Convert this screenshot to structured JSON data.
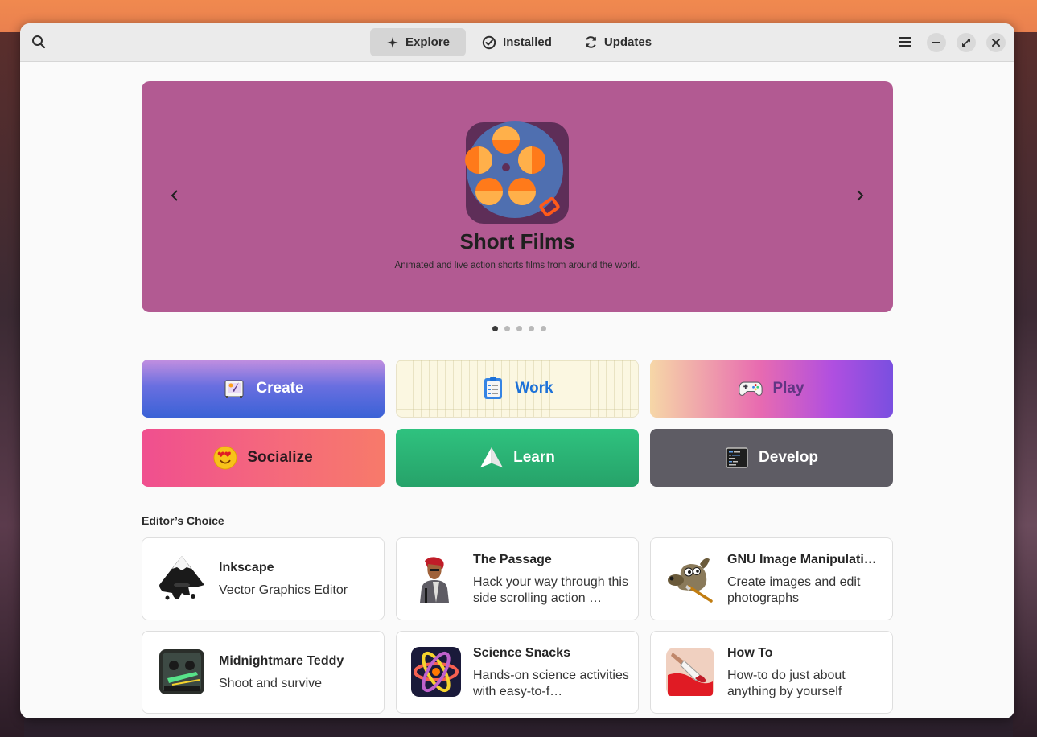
{
  "header": {
    "tabs": [
      {
        "label": "Explore",
        "icon": "explore-icon",
        "active": true
      },
      {
        "label": "Installed",
        "icon": "check-icon",
        "active": false
      },
      {
        "label": "Updates",
        "icon": "refresh-icon",
        "active": false
      }
    ]
  },
  "banner": {
    "title": "Short Films",
    "description": "Animated and live action shorts films from around the world.",
    "color": "#b25a92",
    "page_count": 5,
    "active_page": 1
  },
  "categories": [
    {
      "label": "Create",
      "icon": "create-icon",
      "text_color": "#ffffff"
    },
    {
      "label": "Work",
      "icon": "work-icon",
      "text_color": "#1c71d8"
    },
    {
      "label": "Play",
      "icon": "gamepad-icon",
      "text_color": "#613583"
    },
    {
      "label": "Socialize",
      "icon": "heart-eyes-emoji-icon",
      "text_color": "#2b1a1f"
    },
    {
      "label": "Learn",
      "icon": "paper-plane-icon",
      "text_color": "#ffffff"
    },
    {
      "label": "Develop",
      "icon": "terminal-icon",
      "text_color": "#ffffff"
    }
  ],
  "editors_choice": {
    "title": "Editor’s Choice",
    "apps": [
      {
        "name": "Inkscape",
        "description": "Vector Graphics Editor",
        "icon": "inkscape-icon"
      },
      {
        "name": "The Passage",
        "description": "Hack your way through this side scrolling action …",
        "icon": "the-passage-icon"
      },
      {
        "name": "GNU Image Manipulati…",
        "description": "Create images and edit photographs",
        "icon": "gimp-icon"
      },
      {
        "name": "Midnightmare Teddy",
        "description": "Shoot and survive",
        "icon": "midnightmare-teddy-icon"
      },
      {
        "name": "Science Snacks",
        "description": "Hands-on science activities with easy-to-f…",
        "icon": "science-snacks-icon"
      },
      {
        "name": "How To",
        "description": "How-to do just about anything by yourself",
        "icon": "how-to-icon"
      }
    ]
  }
}
